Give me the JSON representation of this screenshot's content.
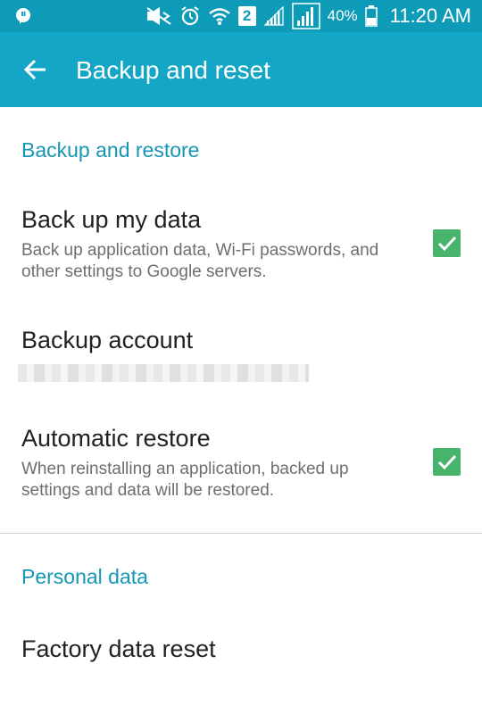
{
  "status_bar": {
    "battery_percent": "40%",
    "time": "11:20 AM",
    "sim_number": "2",
    "icons": [
      "message-icon",
      "mute-icon",
      "alarm-icon",
      "wifi-icon",
      "sim2-icon",
      "signal-icon",
      "signal-icon",
      "battery-icon"
    ]
  },
  "app_bar": {
    "title": "Backup and reset",
    "back_icon": "arrow-back-icon"
  },
  "sections": {
    "backup": {
      "header": "Backup and restore",
      "back_up_data": {
        "title": "Back up my data",
        "summary": "Back up application data, Wi-Fi passwords, and other settings to Google servers.",
        "checked": true
      },
      "backup_account": {
        "title": "Backup account"
      },
      "automatic_restore": {
        "title": "Automatic restore",
        "summary": "When reinstalling an application, backed up settings and data will be restored.",
        "checked": true
      }
    },
    "personal": {
      "header": "Personal data",
      "factory_reset": {
        "title": "Factory data reset"
      }
    }
  },
  "colors": {
    "status_bar": "#0e9bb8",
    "app_bar": "#14a6c6",
    "accent": "#1596b5",
    "checkbox": "#47b36b"
  }
}
